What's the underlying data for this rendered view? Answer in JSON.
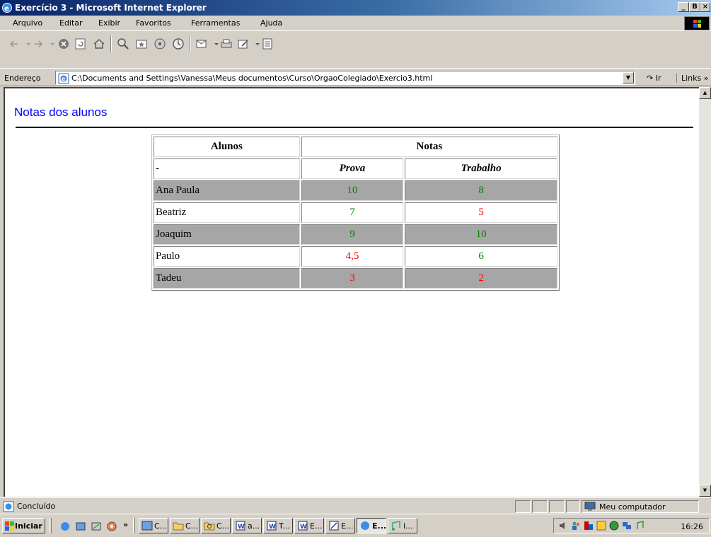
{
  "window": {
    "title": "Exercício 3 - Microsoft Internet Explorer",
    "minimize": "_",
    "restore": "B",
    "close": "×"
  },
  "menu": [
    "Arquivo",
    "Editar",
    "Exibir",
    "Favoritos",
    "Ferramentas",
    "Ajuda"
  ],
  "address_bar": {
    "label": "Endereço",
    "value": "C:\\Documents and Settings\\Vanessa\\Meus documentos\\Curso\\OrgaoColegiado\\Exercio3.html",
    "go_label": "Ir",
    "links_label": "Links »"
  },
  "page": {
    "heading": "Notas dos alunos",
    "table": {
      "header_students": "Alunos",
      "header_grades": "Notas",
      "sub_first": "-",
      "sub_prova": "Prova",
      "sub_trabalho": "Trabalho",
      "rows": [
        {
          "name": "Ana Paula",
          "prova": "10",
          "trabalho": "8",
          "prova_color": "#008000",
          "trabalho_color": "#008000"
        },
        {
          "name": "Beatriz",
          "prova": "7",
          "trabalho": "5",
          "prova_color": "#008000",
          "trabalho_color": "#ff0000"
        },
        {
          "name": "Joaquim",
          "prova": "9",
          "trabalho": "10",
          "prova_color": "#008000",
          "trabalho_color": "#008000"
        },
        {
          "name": "Paulo",
          "prova": "4,5",
          "trabalho": "6",
          "prova_color": "#ff0000",
          "trabalho_color": "#008000"
        },
        {
          "name": "Tadeu",
          "prova": "3",
          "trabalho": "2",
          "prova_color": "#ff0000",
          "trabalho_color": "#ff0000"
        }
      ]
    }
  },
  "status_bar": {
    "text": "Concluído",
    "zone": "Meu computador"
  },
  "taskbar": {
    "start": "Iniciar",
    "chevron": "»",
    "tasks": [
      "C...",
      "C...",
      "C...",
      "a...",
      "T...",
      "E...",
      "E...",
      "E...",
      "i..."
    ],
    "clock": "16:26"
  },
  "colors": {
    "heading": "#0000ff",
    "pass": "#008000",
    "fail": "#ff0000",
    "shaded_row": "#a6a6a6"
  }
}
